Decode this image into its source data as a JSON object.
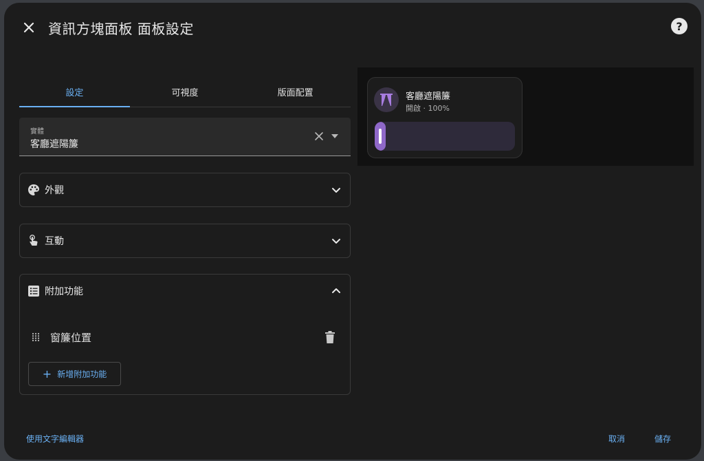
{
  "dialog": {
    "title": "資訊方塊面板 面板設定",
    "close_icon": "close-icon",
    "help_icon": "help-icon",
    "help_glyph": "?"
  },
  "tabs": [
    {
      "label": "設定",
      "active": true
    },
    {
      "label": "可視度",
      "active": false
    },
    {
      "label": "版面配置",
      "active": false
    }
  ],
  "entity": {
    "label": "實體",
    "value": "客廳遮陽簾"
  },
  "panels": {
    "appearance": {
      "label": "外觀",
      "icon": "palette-icon",
      "expanded": false
    },
    "interaction": {
      "label": "互動",
      "icon": "gesture-tap-icon",
      "expanded": false
    },
    "features": {
      "label": "附加功能",
      "icon": "list-box-icon",
      "expanded": true,
      "items": [
        {
          "label": "窗簾位置"
        }
      ],
      "add_label": "新增附加功能",
      "add_glyph": "+"
    }
  },
  "preview": {
    "tile": {
      "name": "客廳遮陽簾",
      "state": "開啟 · 100%",
      "icon": "curtains-icon",
      "position_fraction": 0.05
    }
  },
  "footer": {
    "text_editor": "使用文字編輯器",
    "cancel": "取消",
    "save": "儲存"
  },
  "colors": {
    "accent": "#6ab0f3",
    "tile_accent": "#8f68c9",
    "background": "#1c1c1c"
  }
}
